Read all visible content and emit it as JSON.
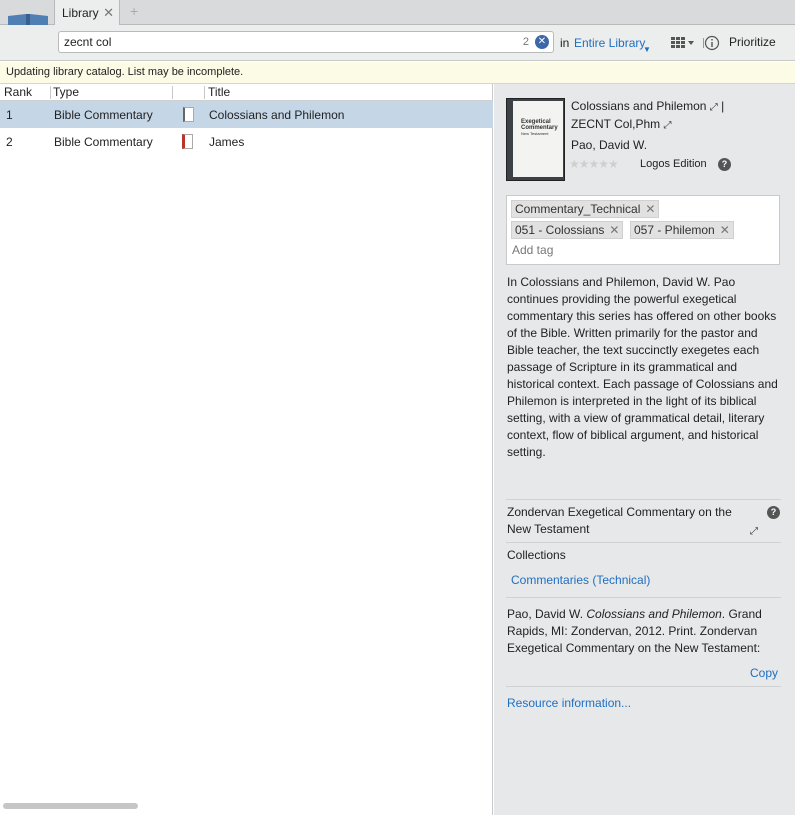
{
  "app": {
    "tab_label": "Library"
  },
  "search": {
    "value": "zecnt col",
    "result_count": "2",
    "scope_prefix": "in",
    "scope": "Entire Library",
    "prioritize_label": "Prioritize"
  },
  "notice": "Updating library catalog. List may be incomplete.",
  "table": {
    "headers": {
      "rank": "Rank",
      "type": "Type",
      "title": "Title"
    },
    "rows": [
      {
        "rank": "1",
        "type": "Bible Commentary",
        "title": "Colossians and Philemon"
      },
      {
        "rank": "2",
        "type": "Bible Commentary",
        "title": "James"
      }
    ]
  },
  "details": {
    "title_line1": "Colossians and Philemon",
    "title_line2": "ZECNT Col,Phm",
    "author": "Pao, David W.",
    "edition": "Logos Edition",
    "rating_stars": 0,
    "cover": {
      "line1": "Exegetical",
      "line2": "Commentary",
      "line3": "New Testament"
    },
    "tags": [
      "Commentary_Technical",
      "051 - Colossians",
      "057 - Philemon"
    ],
    "add_tag_placeholder": "Add tag",
    "description": "In Colossians and Philemon, David W. Pao continues providing the powerful exegetical commentary this series has offered on other books of the Bible. Written primarily for the pastor and Bible teacher, the text succinctly exegetes each passage of Scripture in its grammatical and historical context. Each passage of Colossians and Philemon is interpreted in the light of its biblical setting, with a view of grammatical detail, literary context, flow of biblical argument, and historical setting.",
    "series": "Zondervan Exegetical Commentary on the New Testament",
    "collections_label": "Collections",
    "collection": "Commentaries (Technical)",
    "citation_pre": "Pao, David W. ",
    "citation_italic": "Colossians and Philemon",
    "citation_post": ". Grand Rapids, MI: Zondervan, 2012. Print. Zondervan Exegetical Commentary on the New Testament:",
    "copy_label": "Copy",
    "resource_info_label": "Resource information..."
  }
}
